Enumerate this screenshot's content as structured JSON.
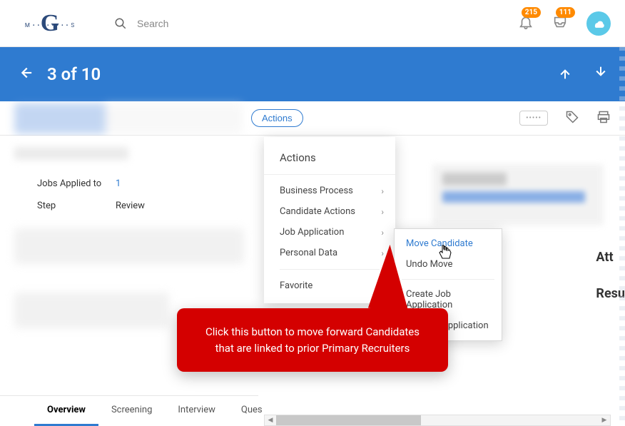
{
  "topnav": {
    "search_placeholder": "Search",
    "notif_count": "215",
    "inbox_count": "111"
  },
  "header": {
    "title": "3 of 10"
  },
  "actions_button": "Actions",
  "info": {
    "jobs_label": "Jobs Applied to",
    "jobs_value": "1",
    "step_label": "Step",
    "step_value": "Review"
  },
  "tabs": [
    "Overview",
    "Screening",
    "Interview",
    "Questionnaire"
  ],
  "dropdown": {
    "title": "Actions",
    "items": [
      {
        "label": "Business Process",
        "has_sub": true
      },
      {
        "label": "Candidate Actions",
        "has_sub": true
      },
      {
        "label": "Job Application",
        "has_sub": true
      },
      {
        "label": "Personal Data",
        "has_sub": true
      }
    ],
    "favorite_label": "Favorite"
  },
  "submenu": {
    "items_top": [
      "Move Candidate",
      "Undo Move"
    ],
    "items_bottom": [
      "Create Job Application",
      "Edit Job Application"
    ]
  },
  "right_labels": {
    "attach": "Att",
    "resume": "Resu"
  },
  "callout_text": "Click this button to move forward Candidates that are linked to prior Primary Recruiters"
}
